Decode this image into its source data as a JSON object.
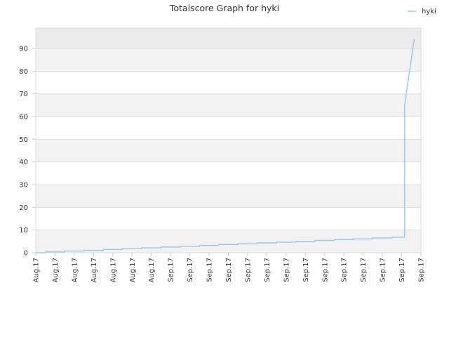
{
  "chart_data": {
    "type": "line",
    "title": "Totalscore Graph for hyki",
    "xlabel": "",
    "ylabel": "",
    "ylim": [
      0,
      99
    ],
    "yticks": [
      0,
      10,
      20,
      30,
      40,
      50,
      60,
      70,
      80,
      90
    ],
    "x_tick_labels": [
      "Aug.17",
      "Aug.17",
      "Aug.17",
      "Aug.17",
      "Aug.17",
      "Aug.17",
      "Aug.17",
      "Sep.17",
      "Sep.17",
      "Sep.17",
      "Sep.17",
      "Sep.17",
      "Sep.17",
      "Sep.17",
      "Sep.17",
      "Sep.17",
      "Sep.17",
      "Sep.17",
      "Sep.17",
      "Sep.17",
      "Sep.17"
    ],
    "grid": "horizontal alternating bands",
    "legend_position": "top-right",
    "colors": {
      "series": "#9ecae9",
      "band": "#f2f2f2",
      "top_band": "#ebebeb",
      "grid": "#dddddd"
    },
    "series": [
      {
        "name": "hyki",
        "x": [
          0,
          0.5,
          0.5,
          1.5,
          1.5,
          2.5,
          2.5,
          3.5,
          3.5,
          4.5,
          4.5,
          5.5,
          5.5,
          6.5,
          6.5,
          7.5,
          7.5,
          8.5,
          8.5,
          9.5,
          9.5,
          10.5,
          10.5,
          11.5,
          11.5,
          12.5,
          12.5,
          13.5,
          13.5,
          14.5,
          14.5,
          15.5,
          15.5,
          16.5,
          16.5,
          17.5,
          17.5,
          18.5,
          18.5,
          19.15,
          19.15,
          19.15,
          19.65
        ],
        "y": [
          0,
          0,
          0.36,
          0.36,
          0.72,
          0.72,
          1.08,
          1.08,
          1.44,
          1.44,
          1.8,
          1.8,
          2.16,
          2.16,
          2.52,
          2.52,
          2.88,
          2.88,
          3.24,
          3.24,
          3.6,
          3.6,
          3.96,
          3.96,
          4.32,
          4.32,
          4.68,
          4.68,
          5.04,
          5.04,
          5.4,
          5.4,
          5.76,
          5.76,
          6.12,
          6.12,
          6.48,
          6.48,
          6.84,
          6.84,
          7.2,
          65,
          94
        ]
      }
    ]
  }
}
